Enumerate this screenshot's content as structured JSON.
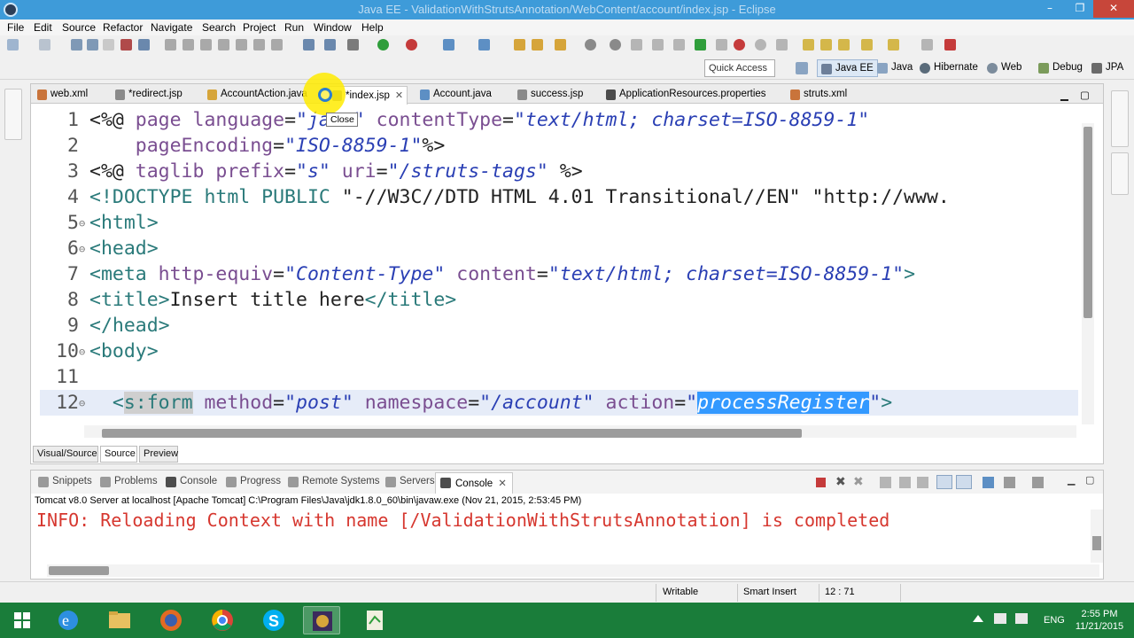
{
  "window": {
    "title": "Java EE - ValidationWithStrutsAnnotation/WebContent/account/index.jsp - Eclipse",
    "controls": [
      "–",
      "❐",
      "✕"
    ]
  },
  "menu": [
    "File",
    "Edit",
    "Source",
    "Refactor",
    "Navigate",
    "Search",
    "Project",
    "Run",
    "Window",
    "Help"
  ],
  "quick_access": {
    "placeholder": "Quick Access"
  },
  "perspectives": [
    "Java EE",
    "Java",
    "Hibernate",
    "Web",
    "Debug",
    "JPA"
  ],
  "editor_tabs": [
    {
      "label": "web.xml",
      "active": false
    },
    {
      "label": "*redirect.jsp",
      "active": false
    },
    {
      "label": "AccountAction.java",
      "active": false
    },
    {
      "label": "*index.jsp",
      "active": true
    },
    {
      "label": "Account.java",
      "active": false
    },
    {
      "label": "success.jsp",
      "active": false
    },
    {
      "label": "ApplicationResources.properties",
      "active": false
    },
    {
      "label": "struts.xml",
      "active": false
    }
  ],
  "tooltip": "Close",
  "code": {
    "line_numbers": [
      "1",
      "2",
      "3",
      "4",
      "5",
      "6",
      "7",
      "8",
      "9",
      "10",
      "11",
      "12"
    ],
    "l1": {
      "t1": "<%@ ",
      "a1": "page ",
      "a2": "language",
      "t2": "=",
      "s1": "\"java\" ",
      "a3": "contentType",
      "t3": "=",
      "s2": "\"text/html; charset=ISO-8859-1\""
    },
    "l2": {
      "pad": "    ",
      "a1": "pageEncoding",
      "t1": "=",
      "s1": "\"ISO-8859-1\"",
      "t2": "%>"
    },
    "l3": {
      "t1": "<%@ ",
      "a1": "taglib ",
      "a2": "prefix",
      "t2": "=",
      "s1": "\"s\" ",
      "a3": "uri",
      "t3": "=",
      "s2": "\"/struts-tags\" ",
      "t4": "%>"
    },
    "l4": {
      "t1": "<!DOCTYPE html PUBLIC ",
      "s1": "\"-//W3C//DTD HTML 4.01 Transitional//EN\" ",
      "s2": "\"http://www."
    },
    "l5": {
      "t1": "<html>"
    },
    "l6": {
      "t1": "<head>"
    },
    "l7": {
      "t1": "<meta ",
      "a1": "http-equiv",
      "t2": "=",
      "s1": "\"Content-Type\" ",
      "a2": "content",
      "t3": "=",
      "s2": "\"text/html; charset=ISO-8859-1\"",
      "t4": ">"
    },
    "l8": {
      "t1": "<title>",
      "x1": "Insert title here",
      "t2": "</title>"
    },
    "l9": {
      "t1": "</head>"
    },
    "l10": {
      "t1": "<body>"
    },
    "l11": {
      "t1": ""
    },
    "l12": {
      "pad": "  ",
      "t1": "<",
      "g1": "s:form",
      "t2": " ",
      "a1": "method",
      "t3": "=",
      "s1": "\"post\" ",
      "a2": "namespace",
      "t4": "=",
      "s2": "\"/account\" ",
      "a3": "action",
      "t5": "=",
      "s3": "\"",
      "sel": "processRegister",
      "s4": "\"",
      "t6": ">"
    }
  },
  "editor_bottom_tabs": [
    "Visual/Source",
    "Source",
    "Preview"
  ],
  "console": {
    "tabs": [
      "Snippets",
      "Problems",
      "Console",
      "Progress",
      "Remote Systems",
      "Servers",
      "Console"
    ],
    "active_tab": "Console",
    "server_line": "Tomcat v8.0 Server at localhost [Apache Tomcat] C:\\Program Files\\Java\\jdk1.8.0_60\\bin\\javaw.exe (Nov 21, 2015, 2:53:45 PM)",
    "output": "INFO: Reloading Context with name [/ValidationWithStrutsAnnotation] is completed"
  },
  "status": {
    "writable": "Writable",
    "insert_mode": "Smart Insert",
    "position": "12 : 71"
  },
  "taskbar": {
    "language": "ENG",
    "time": "2:55 PM",
    "date": "11/21/2015"
  },
  "colors": {
    "titlebar": "#3e9bd9",
    "taskbar": "#1a7d3a",
    "tag": "#2a7a7a",
    "attribute": "#7a4e91",
    "string": "#2a3fb4",
    "console_output": "#d6372f",
    "selection": "#3399ff"
  }
}
